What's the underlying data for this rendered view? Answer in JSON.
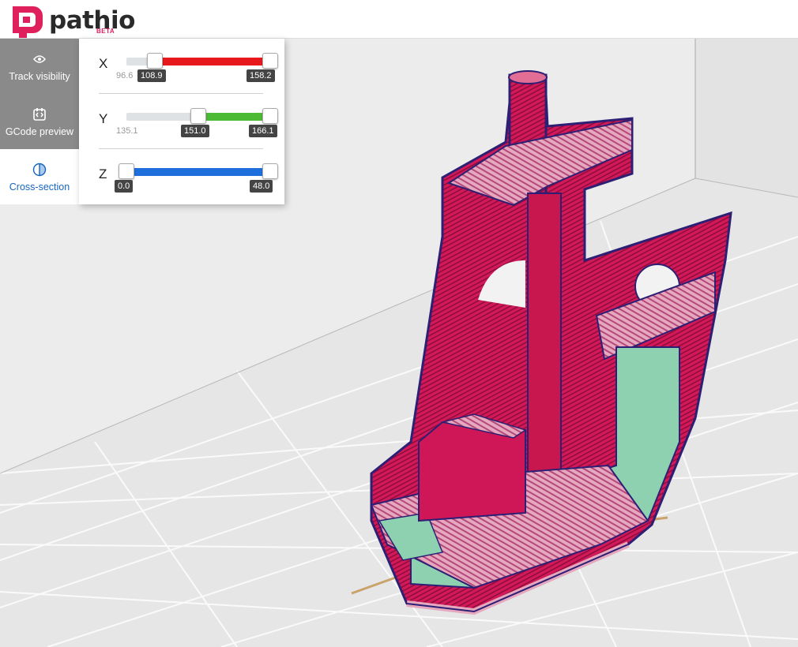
{
  "app": {
    "name": "pathio",
    "badge": "BETA"
  },
  "sidebar": {
    "items": [
      {
        "label": "Track visibility",
        "icon": "eye-icon",
        "active": false
      },
      {
        "label": "GCode preview",
        "icon": "gcode-icon",
        "active": false
      },
      {
        "label": "Cross-section",
        "icon": "cross-section-icon",
        "active": true
      }
    ]
  },
  "cross_section": {
    "x": {
      "label": "X",
      "min": "96.6",
      "low": "108.9",
      "high": "158.2",
      "color": "#e8191c"
    },
    "y": {
      "label": "Y",
      "min": "135.1",
      "low": "151.0",
      "high": "166.1",
      "color": "#4cba35"
    },
    "z": {
      "label": "Z",
      "low": "0.0",
      "high": "48.0",
      "color": "#1e6fdc"
    }
  },
  "colors": {
    "brand": "#e0205d",
    "active_tab_text": "#1565c0",
    "sidebar_bg": "#8a8a8a",
    "model_wall": "#d81b5a",
    "model_infill": "#8ed1b0"
  }
}
